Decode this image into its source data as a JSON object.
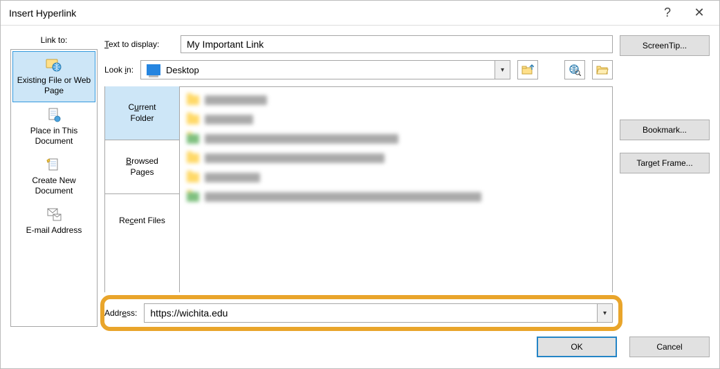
{
  "titlebar": {
    "title": "Insert Hyperlink"
  },
  "linkTo": {
    "label": "Link to:",
    "items": [
      {
        "label": "Existing File or Web Page"
      },
      {
        "label": "Place in This Document"
      },
      {
        "label": "Create New Document"
      },
      {
        "label": "E-mail Address"
      }
    ]
  },
  "textToDisplay": {
    "label": "Text to display:",
    "value": "My Important Link"
  },
  "lookIn": {
    "label": "Look in:",
    "selected": "Desktop"
  },
  "subtabs": [
    {
      "label": "Current Folder"
    },
    {
      "label": "Browsed Pages"
    },
    {
      "label": "Recent Files"
    }
  ],
  "address": {
    "label": "Address:",
    "value": "https://wichita.edu"
  },
  "buttons": {
    "screentip": "ScreenTip...",
    "bookmark": "Bookmark...",
    "targetFrame": "Target Frame...",
    "ok": "OK",
    "cancel": "Cancel"
  }
}
